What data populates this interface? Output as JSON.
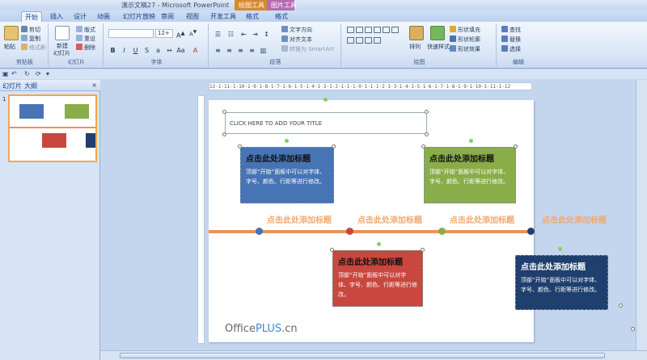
{
  "window": {
    "title": "演示文稿27 - Microsoft PowerPoint",
    "context_tabs": [
      "绘图工具",
      "图片工具"
    ]
  },
  "tabs": [
    "开始",
    "插入",
    "设计",
    "动画",
    "幻灯片放映",
    "审阅",
    "视图",
    "开发工具",
    "格式",
    "格式"
  ],
  "ribbon": {
    "clipboard": {
      "paste": "粘贴",
      "cut": "剪切",
      "copy": "复制",
      "format_painter": "格式刷",
      "label": "剪贴板"
    },
    "slides": {
      "new_slide": "新建",
      "new_slide2": "幻灯片",
      "layout": "版式",
      "reset": "重设",
      "delete": "删除",
      "label": "幻灯片"
    },
    "font": {
      "size": "12+",
      "label": "字体"
    },
    "paragraph": {
      "text_direction": "文字方向",
      "align_text": "对齐文本",
      "smartart": "转换为 SmartArt",
      "label": "段落"
    },
    "drawing": {
      "arrange": "排列",
      "quick_styles": "快速样式",
      "fill": "形状填充",
      "outline": "形状轮廓",
      "effects": "形状效果",
      "label": "绘图"
    },
    "editing": {
      "find": "查找",
      "replace": "替换",
      "select": "选择",
      "label": "编辑"
    }
  },
  "pane": {
    "tab_slides": "幻灯片",
    "tab_outline": "大纲",
    "close": "×",
    "slide_number": "1"
  },
  "ruler": {
    "marks": "12·1·11·1·10·1·9·1·8·1·7·1·6·1·5·1·4·1·3·1·2·1·1·1·0·1·1·1·2·1·3·1·4·1·5·1·6·1·7·1·8·1·9·1·10·1·11·1·12"
  },
  "slide": {
    "title_placeholder": "CLICK HERE TO ADD YOUR TITLE",
    "box_heading": "点击此处添加标题",
    "box_body": "顶部“开始”面板中可以对字体、字号、颜色、行距等进行修改。",
    "timeline_label": "点击此处添加标题",
    "logo_office": "Office",
    "logo_plus": "PLUS",
    "logo_cn": ".cn",
    "colors": {
      "blue": "#4674b4",
      "green": "#89ad48",
      "red": "#c8473f",
      "navy": "#1f3f6e",
      "orange": "#e7935c"
    }
  }
}
